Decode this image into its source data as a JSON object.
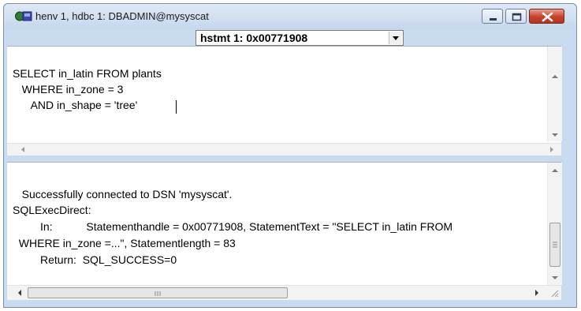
{
  "window": {
    "title": "henv 1, hdbc 1: DBADMIN@mysyscat",
    "controls": {
      "minimize": "minimize",
      "maximize": "maximize",
      "close": "close"
    }
  },
  "statement_select": {
    "value": "hstmt 1:  0x00771908"
  },
  "sql_editor": {
    "lines": [
      "SELECT in_latin FROM plants",
      "   WHERE in_zone = 3",
      "      AND in_shape = 'tree'"
    ]
  },
  "output": {
    "lines": [
      "   Successfully connected to DSN 'mysyscat'.",
      "SQLExecDirect:",
      "         In:           Statementhandle = 0x00771908, StatementText = \"SELECT in_latin FROM",
      "  WHERE in_zone =...\", Statementlength = 83",
      "         Return:  SQL_SUCCESS=0"
    ]
  },
  "icons": {
    "app": "odbc-connection-icon",
    "dropdown": "chevron-down-icon"
  },
  "colors": {
    "frame": "#c9dbee",
    "close_button": "#c7402a"
  }
}
